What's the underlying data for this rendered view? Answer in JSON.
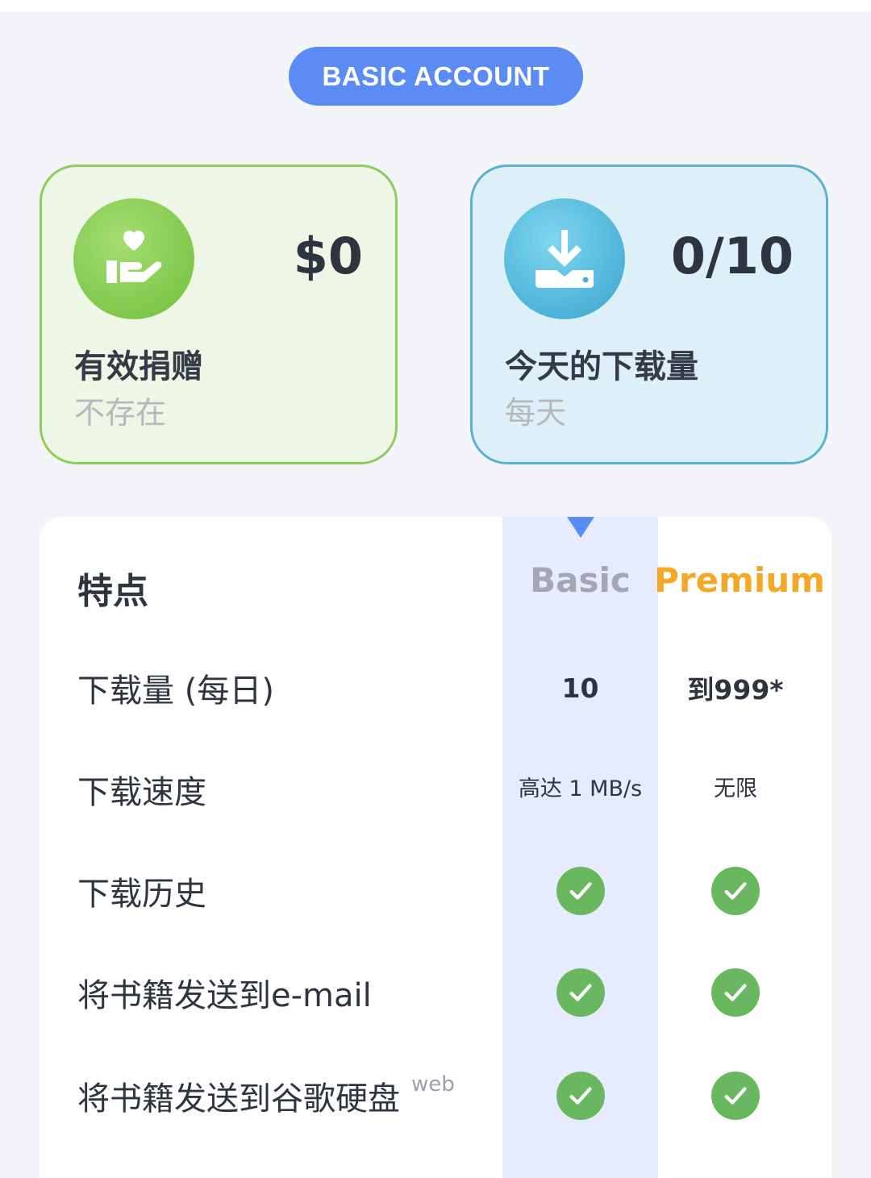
{
  "header": {
    "account_badge": "BASIC ACCOUNT"
  },
  "stats": {
    "donation": {
      "icon": "donation-hand-heart-icon",
      "value": "$0",
      "label": "有效捐赠",
      "sub": "不存在"
    },
    "downloads": {
      "icon": "download-tray-icon",
      "value": "0/10",
      "label": "今天的下载量",
      "sub": "每天"
    }
  },
  "features": {
    "title": "特点",
    "columns": {
      "basic": "Basic",
      "premium": "Premium"
    },
    "rows": [
      {
        "label": "下载量 (每日)",
        "basic": "10",
        "premium": "到999*"
      },
      {
        "label": "下载速度",
        "basic": "高达 1 MB/s",
        "premium": "无限"
      },
      {
        "label": "下载历史",
        "basic": "check",
        "premium": "check"
      },
      {
        "label": "将书籍发送到e-mail",
        "basic": "check",
        "premium": "check"
      },
      {
        "label": "将书籍发送到谷歌硬盘",
        "tag": "web",
        "basic": "check",
        "premium": "check"
      }
    ]
  },
  "colors": {
    "accent": "#5b8cf5",
    "premium": "#f4a826",
    "check": "#69b860"
  }
}
